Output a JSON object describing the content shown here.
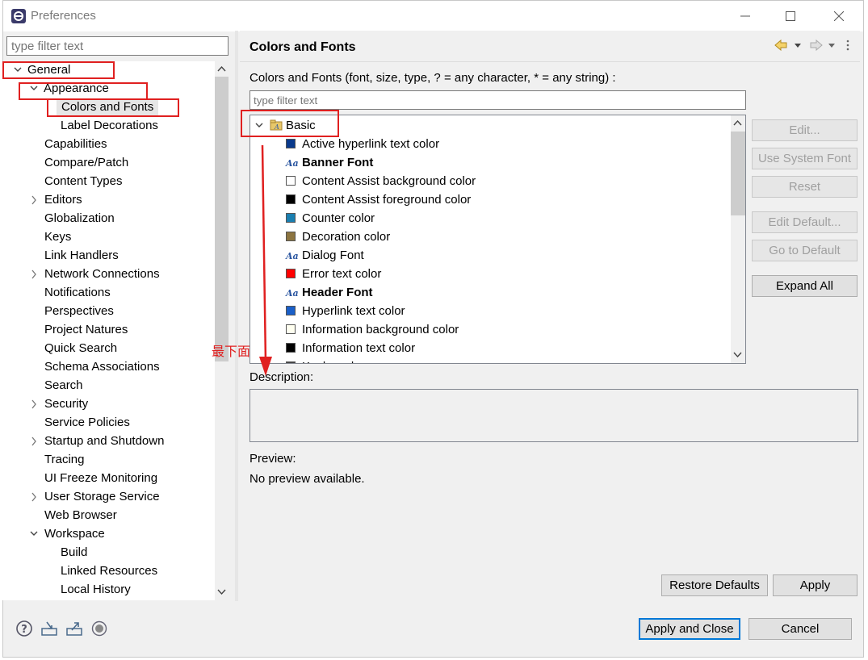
{
  "window": {
    "title": "Preferences"
  },
  "left": {
    "filter_placeholder": "type filter text",
    "items": [
      {
        "label": "General"
      },
      {
        "label": "Appearance"
      },
      {
        "label": "Colors and Fonts"
      },
      {
        "label": "Label Decorations"
      },
      {
        "label": "Capabilities"
      },
      {
        "label": "Compare/Patch"
      },
      {
        "label": "Content Types"
      },
      {
        "label": "Editors"
      },
      {
        "label": "Globalization"
      },
      {
        "label": "Keys"
      },
      {
        "label": "Link Handlers"
      },
      {
        "label": "Network Connections"
      },
      {
        "label": "Notifications"
      },
      {
        "label": "Perspectives"
      },
      {
        "label": "Project Natures"
      },
      {
        "label": "Quick Search"
      },
      {
        "label": "Schema Associations"
      },
      {
        "label": "Search"
      },
      {
        "label": "Security"
      },
      {
        "label": "Service Policies"
      },
      {
        "label": "Startup and Shutdown"
      },
      {
        "label": "Tracing"
      },
      {
        "label": "UI Freeze Monitoring"
      },
      {
        "label": "User Storage Service"
      },
      {
        "label": "Web Browser"
      },
      {
        "label": "Workspace"
      },
      {
        "label": "Build"
      },
      {
        "label": "Linked Resources"
      },
      {
        "label": "Local History"
      }
    ]
  },
  "right": {
    "title": "Colors and Fonts",
    "sub_label": "Colors and Fonts (font, size, type, ? = any character, * = any string) :",
    "filter_placeholder": "type filter text",
    "tree": {
      "root": "Basic",
      "entries": [
        {
          "label": "Active hyperlink text color",
          "kind": "color",
          "color": "#0a3a8c"
        },
        {
          "label": "Banner Font",
          "kind": "font"
        },
        {
          "label": "Content Assist background color",
          "kind": "color",
          "color": "#ffffff"
        },
        {
          "label": "Content Assist foreground color",
          "kind": "color",
          "color": "#000000"
        },
        {
          "label": "Counter color",
          "kind": "color",
          "color": "#1a7fb0"
        },
        {
          "label": "Decoration color",
          "kind": "color",
          "color": "#8c7440"
        },
        {
          "label": "Dialog Font",
          "kind": "font"
        },
        {
          "label": "Error text color",
          "kind": "color",
          "color": "#ff0000"
        },
        {
          "label": "Header Font",
          "kind": "font"
        },
        {
          "label": "Hyperlink text color",
          "kind": "color",
          "color": "#1a5fc8"
        },
        {
          "label": "Information background color",
          "kind": "color",
          "color": "#fffff0"
        },
        {
          "label": "Information text color",
          "kind": "color",
          "color": "#000000"
        },
        {
          "label": "Keyboard ...",
          "kind": "color",
          "color": "#444444"
        }
      ]
    },
    "buttons": {
      "edit": "Edit...",
      "use_system_font": "Use System Font",
      "reset": "Reset",
      "edit_default": "Edit Default...",
      "go_to_default": "Go to Default",
      "expand_all": "Expand All"
    },
    "description_label": "Description:",
    "preview_label": "Preview:",
    "preview_text": "No preview available.",
    "restore_defaults": "Restore Defaults",
    "apply": "Apply"
  },
  "footer": {
    "apply_and_close": "Apply and Close",
    "cancel": "Cancel"
  },
  "annotation": {
    "text": "最下面"
  },
  "colors": {
    "annotation_red": "#e02020",
    "accent_blue": "#0078d7"
  }
}
